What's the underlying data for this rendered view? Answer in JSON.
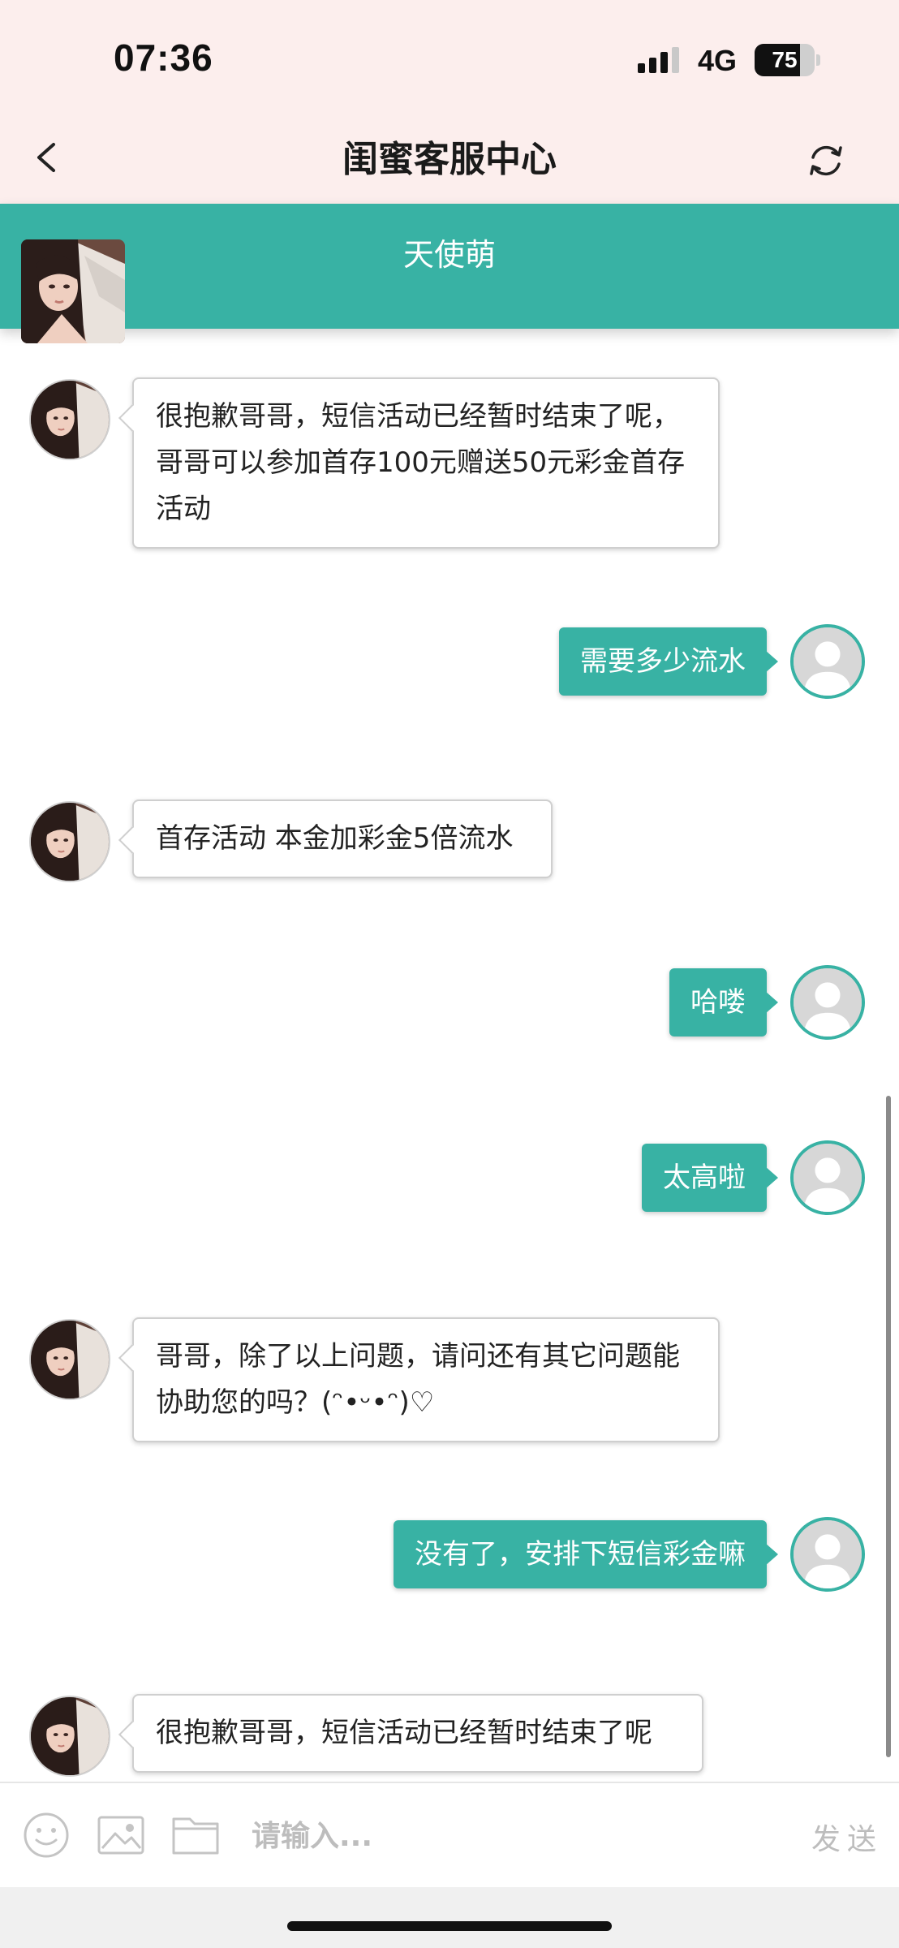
{
  "status_bar": {
    "time": "07:36",
    "network": "4G",
    "battery": "75",
    "battery_level": 0.75
  },
  "nav": {
    "title": "闺蜜客服中心",
    "back_icon": "chevron-left-icon",
    "refresh_icon": "refresh-icon"
  },
  "agent": {
    "name": "天使萌"
  },
  "messages": [
    {
      "from": "agent",
      "text": "很抱歉哥哥，短信活动已经暂时结束了呢，哥哥可以参加首存100元赠送50元彩金首存活动"
    },
    {
      "from": "user",
      "text": "需要多少流水"
    },
    {
      "from": "agent",
      "text": "首存活动 本金加彩金5倍流水"
    },
    {
      "from": "user",
      "text": "哈喽"
    },
    {
      "from": "user",
      "text": "太高啦"
    },
    {
      "from": "agent",
      "text": "哥哥，除了以上问题，请问还有其它问题能协助您的吗？(ᵔ•ᵕ•ᵔ)♡"
    },
    {
      "from": "user",
      "text": "没有了，安排下短信彩金嘛"
    },
    {
      "from": "agent",
      "text": "很抱歉哥哥，短信活动已经暂时结束了呢"
    }
  ],
  "input_bar": {
    "placeholder": "请输入...",
    "send_label": "发送",
    "icons": [
      "emoji-icon",
      "image-icon",
      "folder-icon"
    ]
  },
  "colors": {
    "accent": "#38b2a4",
    "header_bg": "#fceeed",
    "bubble_border": "#cfcfcf"
  }
}
